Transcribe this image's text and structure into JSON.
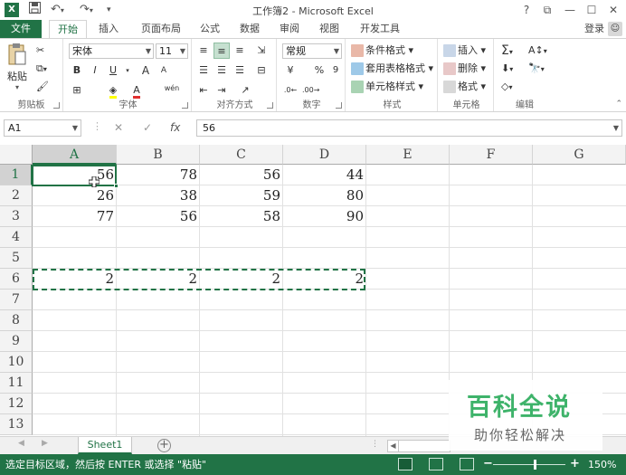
{
  "titlebar": {
    "app_logo": "X",
    "title": "工作簿2 - Microsoft Excel",
    "help": "?",
    "ribbon_options": "⧉",
    "minimize": "—",
    "maximize": "☐",
    "close": "✕"
  },
  "tabs": {
    "file": "文件",
    "items": [
      "开始",
      "插入",
      "页面布局",
      "公式",
      "数据",
      "审阅",
      "视图",
      "开发工具"
    ],
    "active": "开始",
    "login": "登录"
  },
  "ribbon": {
    "clipboard": {
      "paste": "粘贴",
      "label": "剪贴板"
    },
    "font": {
      "name": "宋体",
      "size": "11",
      "bold": "B",
      "italic": "I",
      "underline": "U",
      "grow": "A",
      "shrink": "A",
      "label": "字体",
      "wen": "wén"
    },
    "alignment": {
      "label": "对齐方式"
    },
    "number": {
      "format": "常规",
      "percent": "%",
      "comma": "9",
      "label": "数字"
    },
    "styles": {
      "conditional": "条件格式",
      "table": "套用表格格式",
      "cell": "单元格样式",
      "label": "样式"
    },
    "cells": {
      "insert": "插入",
      "delete": "删除",
      "format": "格式",
      "label": "单元格"
    },
    "editing": {
      "label": "编辑",
      "sigma": "Σ"
    }
  },
  "formula_bar": {
    "name_box": "A1",
    "cancel": "✕",
    "enter": "✓",
    "fx": "fx",
    "value": "56"
  },
  "grid": {
    "columns": [
      "A",
      "B",
      "C",
      "D",
      "E",
      "F",
      "G"
    ],
    "rows": [
      "1",
      "2",
      "3",
      "4",
      "5",
      "6",
      "7",
      "8",
      "9",
      "10",
      "11",
      "12",
      "13"
    ],
    "cells": {
      "r1": [
        "56",
        "78",
        "56",
        "44"
      ],
      "r2": [
        "26",
        "38",
        "59",
        "80"
      ],
      "r3": [
        "77",
        "56",
        "58",
        "90"
      ],
      "r6": [
        "2",
        "2",
        "2",
        "2"
      ]
    },
    "selected_cell": "A1",
    "copy_range": "A6:D6"
  },
  "sheets": {
    "tabs": [
      "Sheet1"
    ],
    "active": "Sheet1",
    "add": "+"
  },
  "status": {
    "message": "选定目标区域，然后按 ENTER 或选择 \"粘贴\"",
    "zoom_minus": "−",
    "zoom_plus": "+",
    "zoom": "150%"
  },
  "watermark": {
    "main": "百科全说",
    "sub": "助你轻松解决"
  },
  "colors": {
    "accent": "#217346",
    "watermark": "#3eb36a"
  }
}
